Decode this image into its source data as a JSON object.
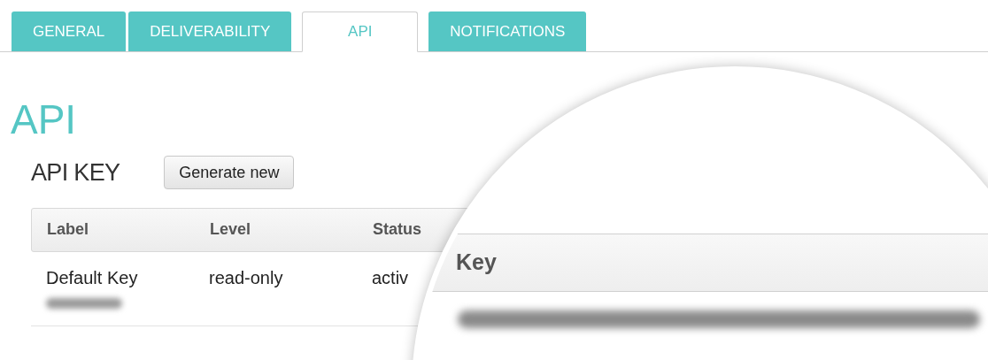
{
  "tabs": [
    {
      "label": "GENERAL",
      "selected": false
    },
    {
      "label": "DELIVERABILITY",
      "selected": false
    },
    {
      "label": "API",
      "selected": true
    },
    {
      "label": "NOTIFICATIONS",
      "selected": false
    }
  ],
  "heading": "API",
  "api_key": {
    "title": "API KEY",
    "button": "Generate new"
  },
  "table": {
    "columns": [
      "Label",
      "Level",
      "Status"
    ],
    "rows": [
      {
        "label": "Default Key",
        "level": "read-only",
        "status": "activ"
      }
    ]
  },
  "magnifier": {
    "column": "Key"
  }
}
